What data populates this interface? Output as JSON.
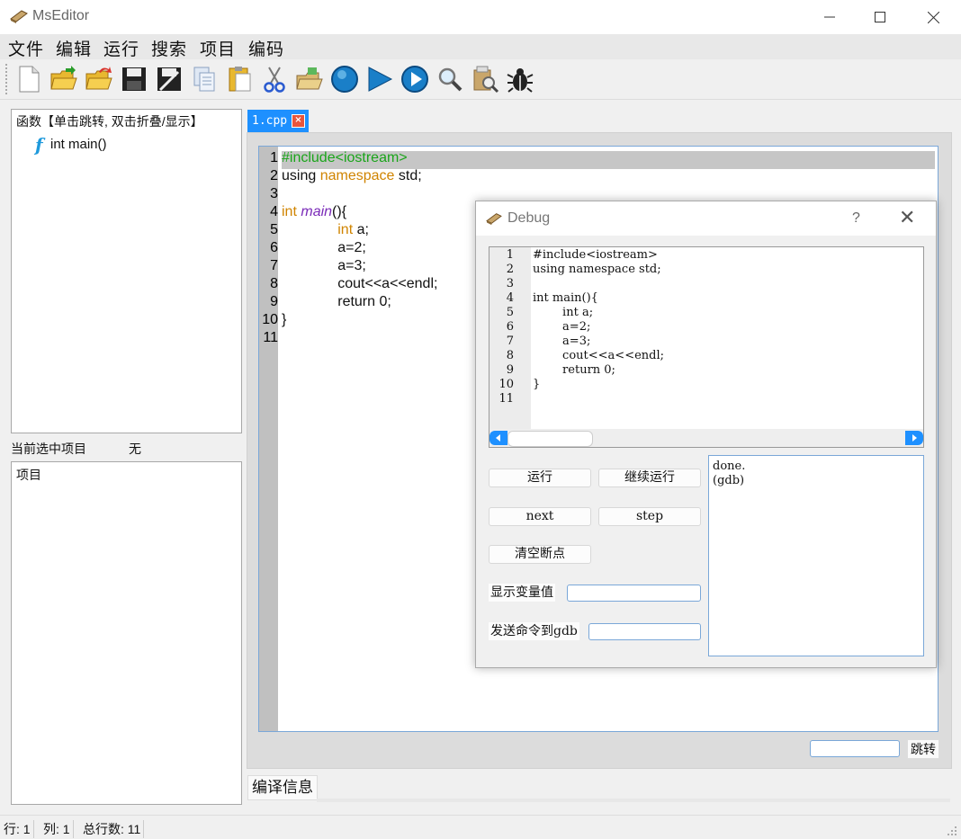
{
  "window": {
    "title": "MsEditor",
    "minimize_icon": "minimize-icon",
    "maximize_icon": "maximize-icon",
    "close_icon": "close-icon"
  },
  "menu": [
    "文件",
    "编辑",
    "运行",
    "搜索",
    "项目",
    "编码"
  ],
  "toolbar": {
    "buttons": [
      "new-file-icon",
      "open-folder-icon",
      "open-recent-icon",
      "save-icon",
      "save-as-icon",
      "copy-icon",
      "paste-icon",
      "cut-icon",
      "open-project-icon",
      "stop-icon",
      "run-icon",
      "run-continue-icon",
      "search-icon",
      "search-replace-icon",
      "debug-bug-icon"
    ]
  },
  "function_panel": {
    "header": "函数【单击跳转, 双击折叠/显示】",
    "icon": "function-icon",
    "items": [
      "int main()"
    ]
  },
  "selection": {
    "label": "当前选中项目",
    "value": "无"
  },
  "project_panel": {
    "label": "项目"
  },
  "editor": {
    "tab_label": "1.cpp",
    "tab_close": "×",
    "line_numbers": [
      "1",
      "2",
      "3",
      "4",
      "5",
      "6",
      "7",
      "8",
      "9",
      "10",
      "11"
    ],
    "lines": [
      [
        {
          "t": "#include<iostream>",
          "c": "inc"
        }
      ],
      [
        {
          "t": "using ",
          "c": ""
        },
        {
          "t": "namespace",
          "c": "type"
        },
        {
          "t": " std;",
          "c": ""
        }
      ],
      [
        {
          "t": "",
          "c": ""
        }
      ],
      [
        {
          "t": "int",
          "c": "type"
        },
        {
          "t": " ",
          "c": ""
        },
        {
          "t": "main",
          "c": "fn"
        },
        {
          "t": "(){",
          "c": ""
        }
      ],
      [
        {
          "t": "              ",
          "c": ""
        },
        {
          "t": "int",
          "c": "type"
        },
        {
          "t": " a;",
          "c": ""
        }
      ],
      [
        {
          "t": "              a=2;",
          "c": ""
        }
      ],
      [
        {
          "t": "              a=3;",
          "c": ""
        }
      ],
      [
        {
          "t": "              cout<<a<<endl;",
          "c": ""
        }
      ],
      [
        {
          "t": "              return 0;",
          "c": ""
        }
      ],
      [
        {
          "t": "}",
          "c": ""
        }
      ],
      [
        {
          "t": "",
          "c": ""
        }
      ]
    ],
    "jump_button": "跳转",
    "compile_tab": "编译信息"
  },
  "status": {
    "row": "行: 1",
    "col": "列: 1",
    "total": "总行数: 11"
  },
  "debug": {
    "title": "Debug",
    "help": "?",
    "close": "✕",
    "code_line_numbers": [
      "1",
      "2",
      "3",
      "4",
      "5",
      "6",
      "7",
      "8",
      "9",
      "10",
      "11"
    ],
    "code_lines": [
      "#include<iostream>",
      "using namespace std;",
      "",
      "int main(){",
      "        int a;",
      "        a=2;",
      "        a=3;",
      "        cout<<a<<endl;",
      "        return 0;",
      "}",
      ""
    ],
    "run_button": "运行",
    "continue_button": "继续运行",
    "next_button": "next",
    "step_button": "step",
    "clear_breakpoints_button": "清空断点",
    "show_var_label": "显示变量值",
    "send_gdb_label": "发送命令到gdb",
    "output_lines": [
      "done.",
      "(gdb)"
    ]
  }
}
